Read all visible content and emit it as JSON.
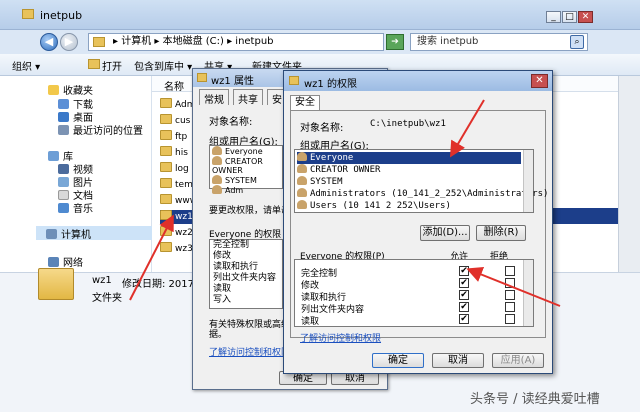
{
  "explorer": {
    "title": "inetpub",
    "address": "▸ 计算机 ▸ 本地磁盘 (C:) ▸ inetpub",
    "search_placeholder": "搜索 inetpub",
    "toolbar": [
      "组织 ▾",
      "打开",
      "包含到库中 ▾",
      "共享 ▾",
      "新建文件夹"
    ],
    "nav": {
      "favorites_label": "收藏夹",
      "favorites": [
        "下载",
        "桌面",
        "最近访问的位置"
      ],
      "library_label": "库",
      "libraries": [
        "视频",
        "图片",
        "文档",
        "音乐"
      ],
      "computer": "计算机",
      "network": "网络"
    },
    "column_name": "名称",
    "files": [
      "Adm",
      "cus",
      "ftp",
      "his",
      "log",
      "tem",
      "www",
      "wz1",
      "wz2",
      "wz3"
    ],
    "status": {
      "name": "wz1",
      "modified_label": "修改日期: 2017/2",
      "type": "文件夹"
    }
  },
  "props": {
    "title": "wz1 属性",
    "tabs": [
      "常规",
      "共享",
      "安"
    ],
    "object_label": "对象名称:",
    "group_label": "组或用户名(G):",
    "users": [
      "Everyone",
      "CREATOR OWNER",
      "SYSTEM",
      "Adm"
    ],
    "change_text": "要更改权限，请单击",
    "perm_label": "Everyone 的权限",
    "perms": [
      "完全控制",
      "修改",
      "读取和执行",
      "列出文件夹内容",
      "读取",
      "写入"
    ],
    "special_text": "有关特殊权限或高级",
    "special_text2": "据。",
    "link": "了解访问控制和权限",
    "ok": "确定",
    "cancel": "取消",
    "apply": "应用(A)"
  },
  "perm": {
    "title": "wz1 的权限",
    "tab": "安全",
    "object_label": "对象名称:",
    "object_value": "C:\\inetpub\\wz1",
    "group_label": "组或用户名(G):",
    "users": [
      "Everyone",
      "CREATOR OWNER",
      "SYSTEM",
      "Administrators (10_141_2_252\\Administrators)",
      "Users (10 141 2 252\\Users)"
    ],
    "add": "添加(D)...",
    "remove": "删除(R)",
    "perm_label": "Everyone 的权限(P)",
    "allow": "允许",
    "deny": "拒绝",
    "perms": [
      {
        "name": "完全控制",
        "allow": "✔",
        "deny": ""
      },
      {
        "name": "修改",
        "allow": "✔",
        "deny": ""
      },
      {
        "name": "读取和执行",
        "allow": "✔",
        "deny": ""
      },
      {
        "name": "列出文件夹内容",
        "allow": "✔",
        "deny": ""
      },
      {
        "name": "读取",
        "allow": "✔",
        "deny": ""
      }
    ],
    "link": "了解访问控制和权限",
    "ok": "确定",
    "cancel": "取消",
    "apply": "应用(A)"
  },
  "watermark": "头条号 / 读经典爱吐槽",
  "colors": {
    "arrow": "#e0302a",
    "selection": "#1c3e8a"
  }
}
